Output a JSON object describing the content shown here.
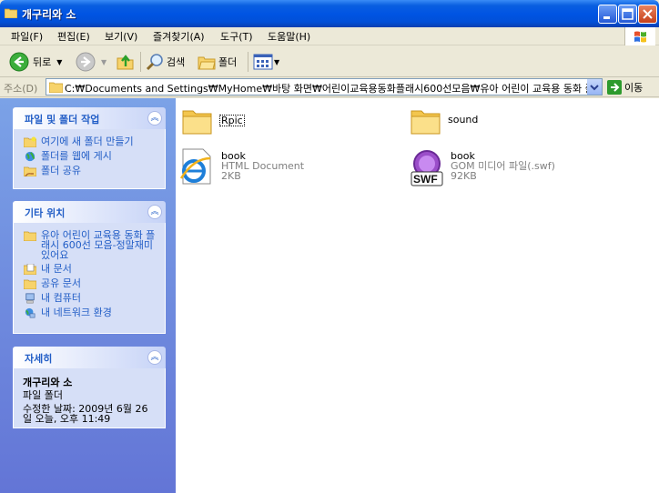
{
  "window": {
    "title": "개구리와 소"
  },
  "menu": {
    "items": [
      "파일(F)",
      "편집(E)",
      "보기(V)",
      "즐겨찾기(A)",
      "도구(T)",
      "도움말(H)"
    ]
  },
  "toolbar": {
    "back_label": "뒤로",
    "search_label": "검색",
    "folders_label": "폴더"
  },
  "address": {
    "label": "주소(D)",
    "path": "C:₩Documents and Settings₩MyHome₩바탕 화면₩어린이교육용동화플래시600선모음₩유아 어린이 교육용 동화 플",
    "go_label": "이동"
  },
  "tasks": {
    "title": "파일 및 폴더 작업",
    "items": [
      "여기에 새 폴더 만들기",
      "폴더를 웹에 게시",
      "폴더 공유"
    ]
  },
  "places": {
    "title": "기타 위치",
    "items": [
      "유아 어린이 교육용 동화 플래시 600선 모음-정말재미있어요",
      "내 문서",
      "공유 문서",
      "내 컴퓨터",
      "내 네트워크 환경"
    ]
  },
  "details": {
    "title": "자세히",
    "name": "개구리와 소",
    "type": "파일 폴더",
    "modified": "수정한 날짜: 2009년 6월 26일 오늘, 오후 11:49"
  },
  "files": [
    {
      "name": "Rpic",
      "type": "",
      "size": "",
      "icon": "folder-icon"
    },
    {
      "name": "sound",
      "type": "",
      "size": "",
      "icon": "folder-icon"
    },
    {
      "name": "book",
      "type": "HTML Document",
      "size": "2KB",
      "icon": "ie-html-icon"
    },
    {
      "name": "book",
      "type": "GOM 미디어 파일(.swf)",
      "size": "92KB",
      "icon": "swf-icon",
      "icon_text": "SWF"
    }
  ],
  "colors": {
    "title_blue": "#0054e3",
    "link_blue": "#215dc6",
    "pane_blue": "#6375d6"
  }
}
